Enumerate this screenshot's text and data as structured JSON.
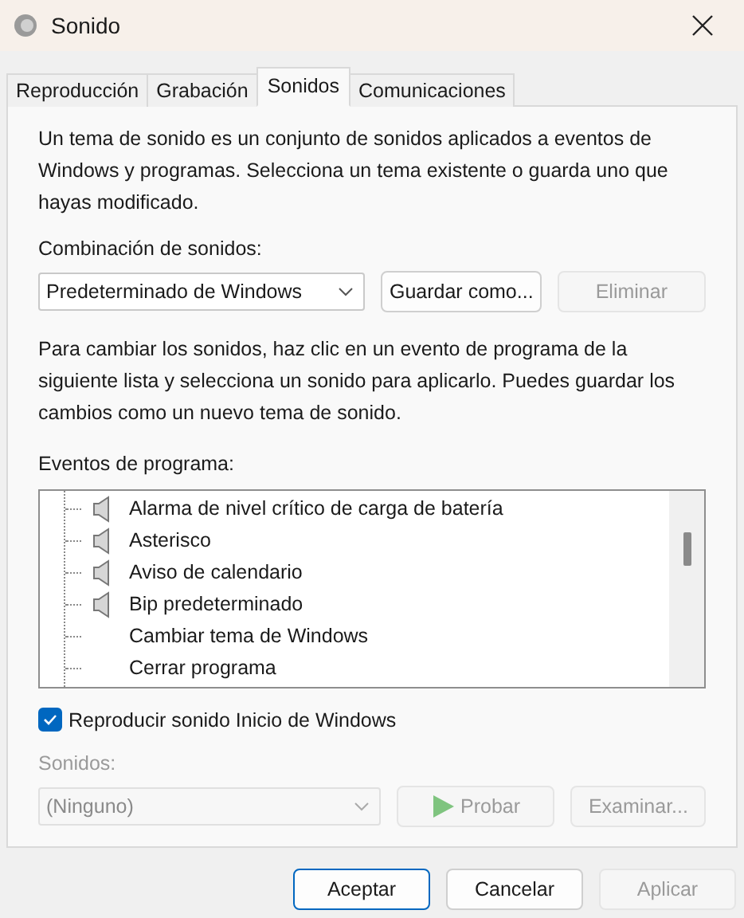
{
  "window": {
    "title": "Sonido"
  },
  "tabs": [
    {
      "label": "Reproducción",
      "selected": false
    },
    {
      "label": "Grabación",
      "selected": false
    },
    {
      "label": "Sonidos",
      "selected": true
    },
    {
      "label": "Comunicaciones",
      "selected": false
    }
  ],
  "description": "Un tema de sonido es un conjunto de sonidos aplicados a eventos de Windows y programas. Selecciona un tema existente o guarda uno que hayas modificado.",
  "scheme": {
    "label": "Combinación de sonidos:",
    "value": "Predeterminado de Windows",
    "buttons": [
      {
        "label": "Guardar como...",
        "disabled": false
      },
      {
        "label": "Eliminar",
        "disabled": true
      }
    ]
  },
  "instructions": "Para cambiar los sonidos, haz clic en un evento de programa de la siguiente lista y selecciona un sonido para aplicarlo. Puedes guardar los cambios como un nuevo tema de sonido.",
  "events": {
    "label": "Eventos de programa:",
    "items": [
      {
        "label": "Alarma de nivel crítico de carga de batería",
        "kind": "sound"
      },
      {
        "label": "Asterisco",
        "kind": "sound"
      },
      {
        "label": "Aviso de calendario",
        "kind": "sound"
      },
      {
        "label": "Bip predeterminado",
        "kind": "sound"
      },
      {
        "label": "Cambiar tema de Windows",
        "kind": "none"
      },
      {
        "label": "Cerrar programa",
        "kind": "none"
      }
    ]
  },
  "startup_sound": {
    "label": "Reproducir sonido Inicio de Windows",
    "checked": true
  },
  "sounds": {
    "label": "Sonidos:",
    "value": "(Ninguno)",
    "disabled": true,
    "buttons": [
      {
        "label": "Probar",
        "kind": "play",
        "disabled": true
      },
      {
        "label": "Examinar...",
        "kind": "plain",
        "disabled": true
      }
    ]
  },
  "footer_buttons": [
    {
      "label": "Aceptar",
      "default": true,
      "disabled": false
    },
    {
      "label": "Cancelar",
      "default": false,
      "disabled": false
    },
    {
      "label": "Aplicar",
      "default": false,
      "disabled": true
    }
  ]
}
